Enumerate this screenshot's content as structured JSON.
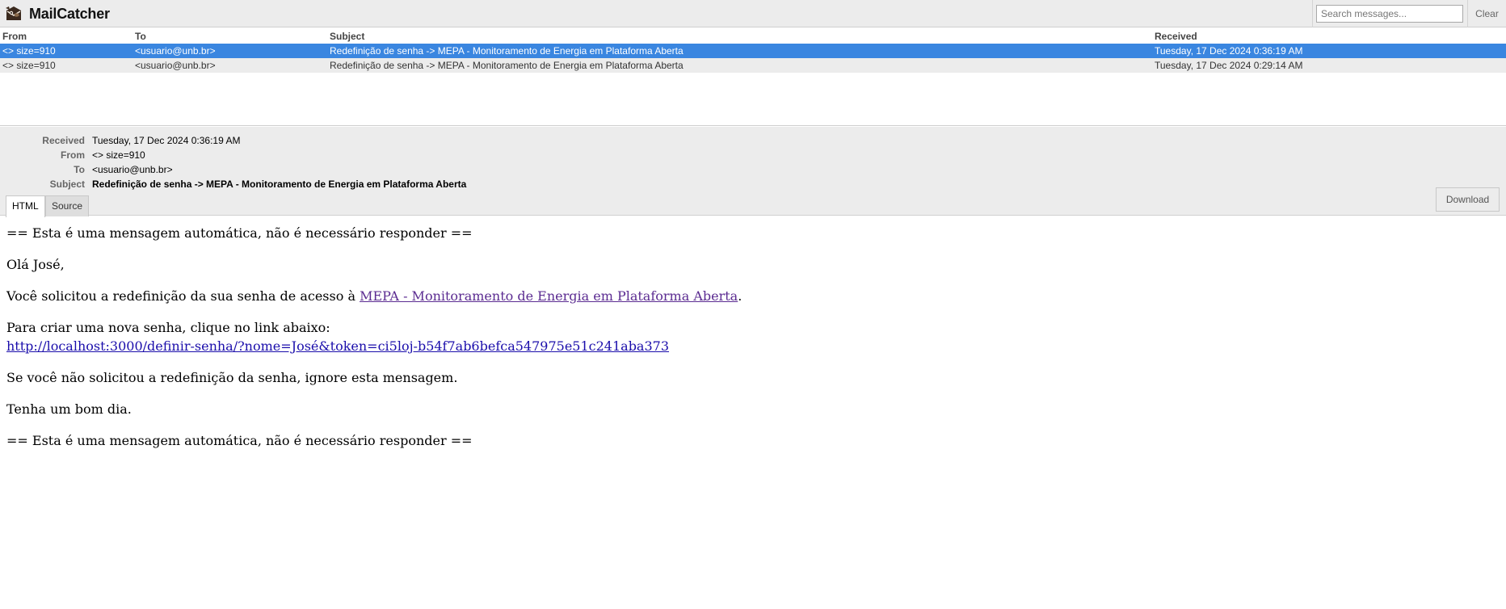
{
  "app": {
    "title": "MailCatcher",
    "logo_icon": "mailcatcher-logo-icon"
  },
  "search": {
    "placeholder": "Search messages..."
  },
  "header": {
    "clear_label": "Clear"
  },
  "list": {
    "columns": {
      "from": "From",
      "to": "To",
      "subject": "Subject",
      "received": "Received"
    },
    "messages": [
      {
        "from": "<> size=910",
        "to": "<usuario@unb.br>",
        "subject": "Redefinição de senha -> MEPA - Monitoramento de Energia em Plataforma Aberta",
        "received": "Tuesday, 17 Dec 2024 0:36:19 AM",
        "selected": true
      },
      {
        "from": "<> size=910",
        "to": "<usuario@unb.br>",
        "subject": "Redefinição de senha -> MEPA - Monitoramento de Energia em Plataforma Aberta",
        "received": "Tuesday, 17 Dec 2024 0:29:14 AM",
        "selected": false
      }
    ]
  },
  "metadata": {
    "received_label": "Received",
    "received_value": "Tuesday, 17 Dec 2024 0:36:19 AM",
    "from_label": "From",
    "from_value": "<> size=910",
    "to_label": "To",
    "to_value": "<usuario@unb.br>",
    "subject_label": "Subject",
    "subject_value": "Redefinição de senha -> MEPA - Monitoramento de Energia em Plataforma Aberta"
  },
  "tabs": {
    "html_label": "HTML",
    "source_label": "Source",
    "download_label": "Download"
  },
  "body": {
    "auto_notice_top": "== Esta é uma mensagem automática, não é necessário responder ==",
    "greeting": "Olá José,",
    "intro_text": "Você solicitou a redefinição da sua senha de acesso à ",
    "intro_link": "MEPA - Monitoramento de Energia em Plataforma Aberta",
    "intro_end": ".",
    "instructions": "Para criar uma nova senha, clique no link abaixo:",
    "reset_link": "http://localhost:3000/definir-senha/?nome=José&token=ci5loj-b54f7ab6befca547975e51c241aba373",
    "ignore_text": "Se você não solicitou a redefinição da senha, ignore esta mensagem.",
    "closing": "Tenha um bom dia.",
    "auto_notice_bottom": "== Esta é uma mensagem automática, não é necessário responder =="
  },
  "colors": {
    "selected_row": "#3a86e0",
    "chrome_bg": "#ececec",
    "link": "#1a0dab",
    "visited_link": "#5b2b91"
  }
}
